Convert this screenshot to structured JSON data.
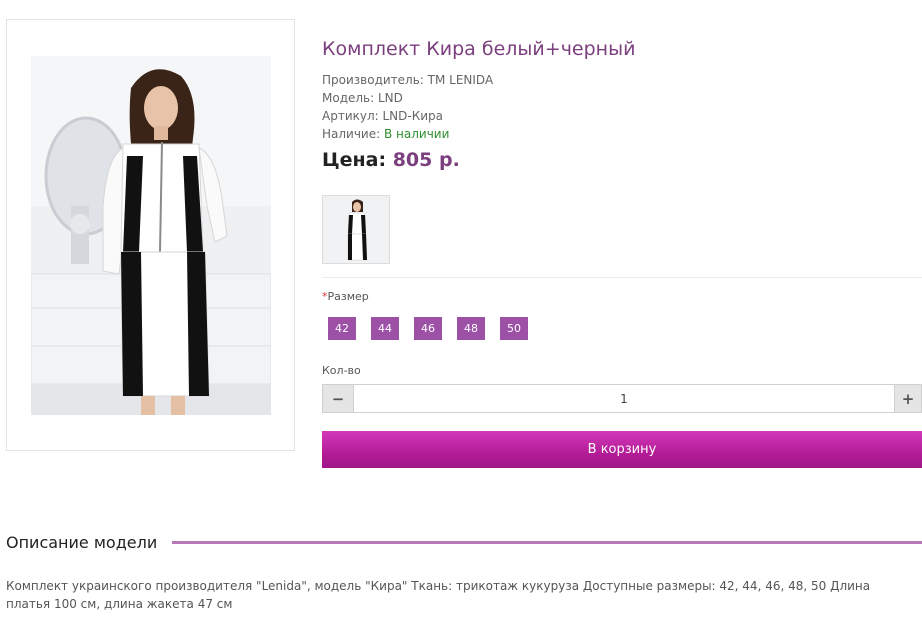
{
  "product": {
    "title": "Комплект Кира белый+черный",
    "manufacturer": "Производитель: TM LENIDA",
    "model": "Модель: LND",
    "sku": "Артикул: LND-Кира",
    "availability_label": "Наличие: ",
    "availability_value": "В наличии",
    "price_label": "Цена: ",
    "price_value": "805 р."
  },
  "options": {
    "size_required_mark": "*",
    "size_label": "Размер",
    "sizes": [
      "42",
      "44",
      "46",
      "48",
      "50"
    ]
  },
  "quantity": {
    "label": "Кол-во",
    "value": "1",
    "minus_icon": "minus-icon",
    "plus_icon": "plus-icon"
  },
  "cart": {
    "button_label": "В корзину"
  },
  "description": {
    "heading": "Описание модели",
    "text": "Комплект украинского производителя \"Lenida\", модель \"Кира\" Ткань: трикотаж кукуруза Доступные размеры: 42, 44, 46, 48, 50 Длина платья 100 см, длина жакета 47 см"
  },
  "colors": {
    "accent": "#9c50a6",
    "title": "#7b3f7e",
    "cart_button": "#b31c97",
    "in_stock": "#2f8f2f"
  }
}
